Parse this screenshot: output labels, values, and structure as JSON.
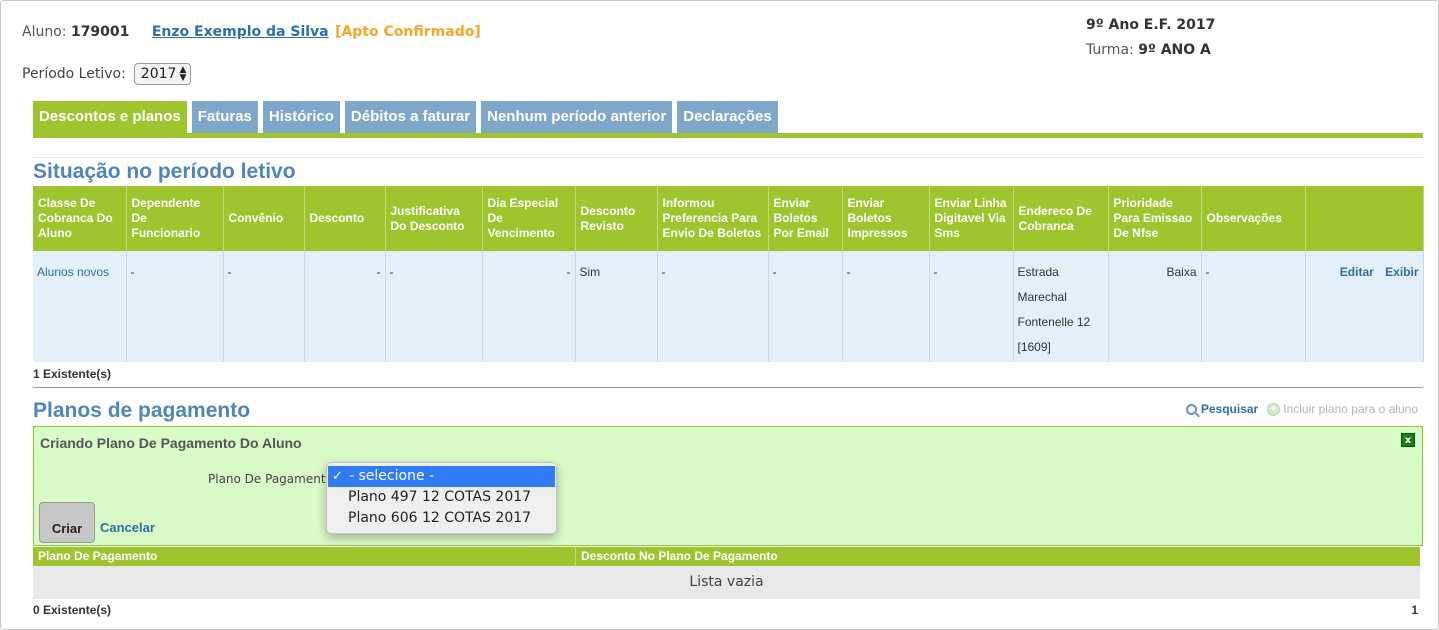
{
  "student": {
    "label": "Aluno:",
    "id": "179001",
    "name": "Enzo Exemplo da Silva",
    "status": "[Apto Confirmado]"
  },
  "class_info": {
    "grade": "9º Ano E.F. 2017",
    "class_label": "Turma:",
    "class_value": "9º ANO A"
  },
  "period": {
    "label": "Período Letivo:",
    "selected": "2017"
  },
  "tabs": [
    {
      "label": "Descontos e planos",
      "active": true
    },
    {
      "label": "Faturas"
    },
    {
      "label": "Histórico"
    },
    {
      "label": "Débitos a faturar"
    },
    {
      "label": "Nenhum período anterior"
    },
    {
      "label": "Declarações"
    }
  ],
  "situation": {
    "title": "Situação no período letivo",
    "headers": [
      "Classe De Cobranca Do Aluno",
      "Dependente De Funcionario",
      "Convênio",
      "Desconto",
      "Justificativa Do Desconto",
      "Dia Especial De Vencimento",
      "Desconto Revisto",
      "Informou Preferencia Para Envio De Boletos",
      "Enviar Boletos Por Email",
      "Enviar Boletos Impressos",
      "Enviar Linha Digitavel Via Sms",
      "Endereco De Cobranca",
      "Prioridade Para Emissao De Nfse",
      "Observações",
      ""
    ],
    "row": {
      "classe": "Alunos novos",
      "dependente": "-",
      "convenio": "-",
      "desconto": "-",
      "justificativa": "-",
      "dia_especial": "-",
      "desconto_revisto": "Sim",
      "informou_preferencia": "-",
      "boletos_email": "-",
      "boletos_impressos": "-",
      "linha_sms": "-",
      "endereco": "Estrada Marechal Fontenelle 12 [1609]",
      "prioridade": "Baixa",
      "observacoes": "-",
      "edit_label": "Editar",
      "view_label": "Exibir"
    },
    "count": "1 Existente(s)"
  },
  "payment_plans": {
    "title": "Planos de pagamento",
    "search_label": "Pesquisar",
    "include_label": "Incluir plano para o aluno",
    "form": {
      "title": "Criando Plano De Pagamento Do Aluno",
      "close_label": "x",
      "field_label": "Plano De Pagamento",
      "options": [
        "- selecione -",
        "Plano 497 12 COTAS 2017",
        "Plano 606 12 COTAS 2017"
      ],
      "check_mark": "✓",
      "create_label": "Criar",
      "cancel_label": "Cancelar"
    },
    "list_headers": [
      "Plano De Pagamento",
      "Desconto No Plano De Pagamento"
    ],
    "empty_text": "Lista vazia",
    "count": "0 Existente(s)",
    "page": "1"
  },
  "colors": {
    "accent_green": "#9ec52e",
    "tab_blue": "#7fa7c9",
    "title_blue": "#4f86b8",
    "link_blue": "#2e6fa7",
    "status_orange": "#f5a623",
    "panel_green": "#d9fbc7",
    "row_blue": "#e3f0fa"
  },
  "icons": {
    "search": "magnifier-icon",
    "include": "plus-circle-icon",
    "close": "close-icon",
    "select": "select-arrows-icon"
  }
}
